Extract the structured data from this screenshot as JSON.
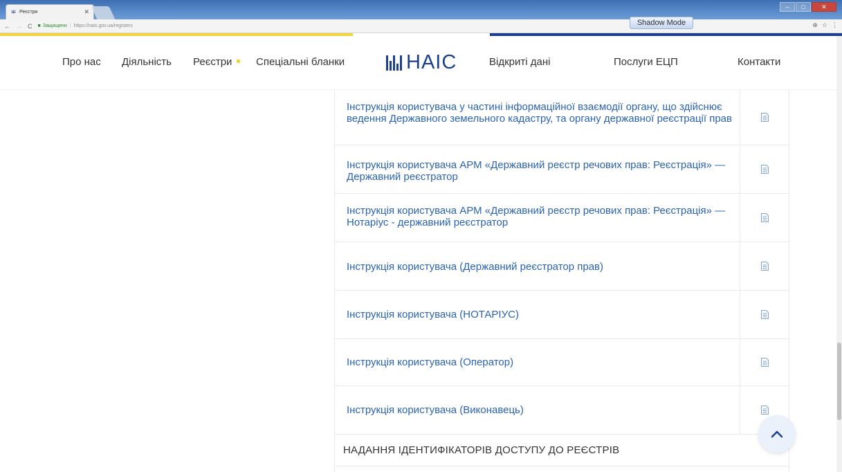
{
  "browser": {
    "tab_title": "Реєстри",
    "tab_favicon_text": "Ш",
    "secure_label": "Защищено",
    "url": "https://nais.gov.ua/registers",
    "shadow_mode_label": "Shadow Mode"
  },
  "site": {
    "logo_text": "НАІС",
    "nav_left": [
      "Про нас",
      "Діяльність",
      "Реєстри",
      "Спеціальні бланки"
    ],
    "nav_right": [
      "Відкриті дані",
      "Послуги ЕЦП",
      "Контакти"
    ],
    "colors": {
      "brand_blue": "#1c3f8d",
      "accent_yellow": "#f5d33b",
      "link_blue": "#2a63b4"
    }
  },
  "documents": [
    {
      "title": "Інструкція користувача у частині інформаційної взаємодії органу, що здійснює ведення Державного земельного кадастру, та органу державної реєстрації прав",
      "icon": "document-icon"
    },
    {
      "title": "Інструкція користувача АРМ «Державний реєстр речових прав: Реєстрація» — Державний реєстратор",
      "icon": "document-icon"
    },
    {
      "title": "Інструкція користувача АРМ «Державний реєстр речових прав: Реєстрація» — Нотаріус - державний реєстратор",
      "icon": "document-icon"
    },
    {
      "title": "Інструкція користувача (Державний реєстратор прав)",
      "icon": "document-icon"
    },
    {
      "title": "Інструкція користувача (НОТАРІУС)",
      "icon": "document-icon"
    },
    {
      "title": "Інструкція користувача (Оператор)",
      "icon": "document-icon"
    },
    {
      "title": "Інструкція користувача (Виконавець)",
      "icon": "document-icon"
    }
  ],
  "section_heading": "НАДАННЯ ІДЕНТИФІКАТОРІВ ДОСТУПУ ДО РЕЄСТРІВ"
}
